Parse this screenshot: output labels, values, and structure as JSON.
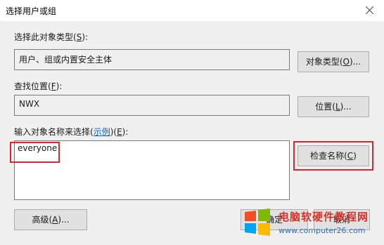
{
  "dialog": {
    "title": "选择用户或组"
  },
  "object_type": {
    "label_prefix": "选择此对象类型(",
    "label_key": "S",
    "label_suffix": "):",
    "value": "用户、组或内置安全主体",
    "button_prefix": "对象类型(",
    "button_key": "O",
    "button_suffix": ")..."
  },
  "location": {
    "label_prefix": "查找位置(",
    "label_key": "F",
    "label_suffix": "):",
    "value": "NWX",
    "button_prefix": "位置(",
    "button_key": "L",
    "button_suffix": ")..."
  },
  "names": {
    "label_prefix": "输入对象名称来选择(",
    "label_link": "示例",
    "label_mid": ")(",
    "label_key": "E",
    "label_suffix": "):",
    "value": "everyone",
    "check_prefix": "检查名称(",
    "check_key": "C",
    "check_suffix": ")"
  },
  "advanced": {
    "prefix": "高级(",
    "key": "A",
    "suffix": ")..."
  },
  "ok_partial": "确定",
  "cancel_partial": "取消",
  "watermark": {
    "title": "电脑软硬件教程网",
    "url": "www.computer26.com"
  },
  "colors": {
    "highlight": "#d9262f"
  }
}
